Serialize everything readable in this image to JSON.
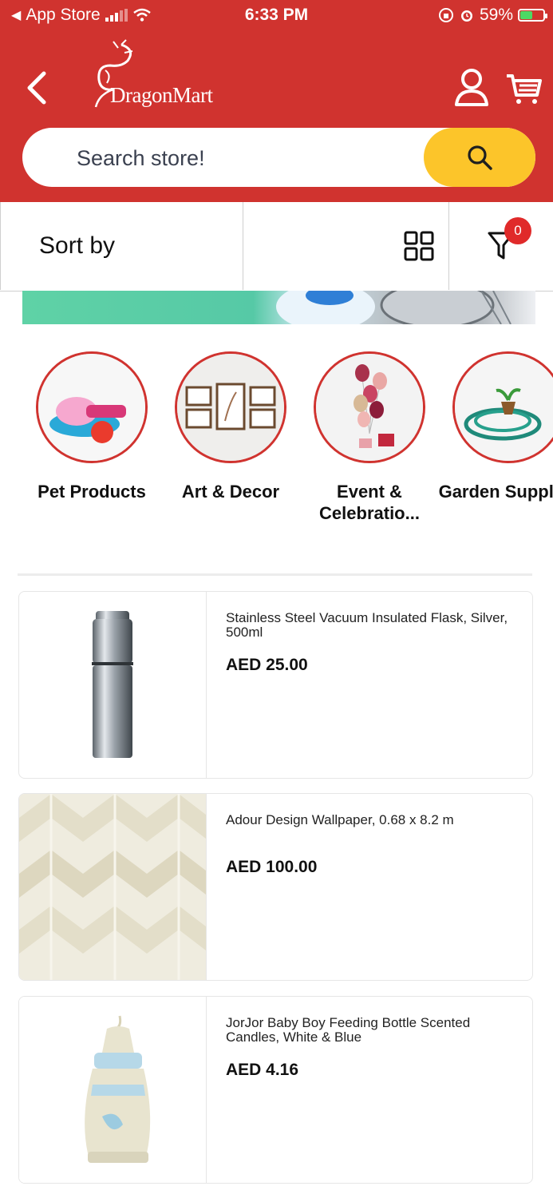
{
  "status_bar": {
    "back_app": "App Store",
    "time": "6:33 PM",
    "battery": "59%",
    "battery_level": 0.59
  },
  "header": {
    "brand": "DragonMart",
    "search_placeholder": "Search store!",
    "background_color": "#d0332f",
    "search_button_color": "#fcc52a"
  },
  "toolbar": {
    "sort_label": "Sort by",
    "filter_count": "0"
  },
  "categories": [
    {
      "label": "Pet Products"
    },
    {
      "label": "Art & Decor"
    },
    {
      "label": "Event & Celebratio..."
    },
    {
      "label": "Garden Supplies"
    }
  ],
  "products": [
    {
      "name": "Stainless Steel Vacuum Insulated Flask, Silver, 500ml",
      "price": "AED 25.00"
    },
    {
      "name": "Adour Design Wallpaper, 0.68 x 8.2 m",
      "price": "AED 100.00"
    },
    {
      "name": "JorJor Baby Boy Feeding Bottle Scented Candles, White & Blue",
      "price": "AED 4.16"
    }
  ]
}
